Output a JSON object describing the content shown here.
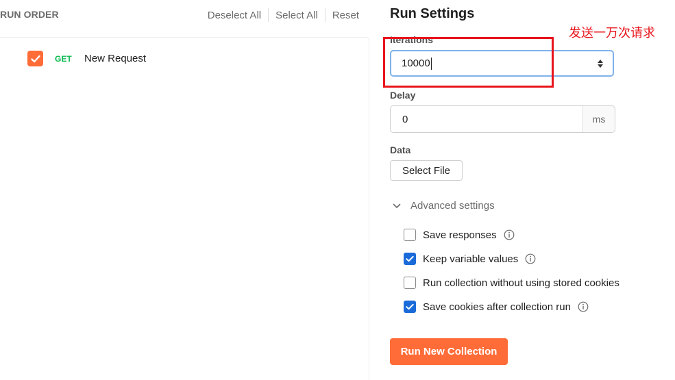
{
  "run_order": {
    "title": "RUN ORDER",
    "actions": {
      "deselect_all": "Deselect All",
      "select_all": "Select All",
      "reset": "Reset"
    },
    "requests": [
      {
        "method": "GET",
        "name": "New Request",
        "checked": true
      }
    ]
  },
  "run_settings": {
    "title": "Run Settings",
    "iterations": {
      "label": "Iterations",
      "value": "10000"
    },
    "delay": {
      "label": "Delay",
      "value": "0",
      "unit": "ms"
    },
    "data": {
      "label": "Data",
      "button": "Select File"
    },
    "advanced": {
      "label": "Advanced settings",
      "options": [
        {
          "label": "Save responses",
          "checked": false,
          "info": true
        },
        {
          "label": "Keep variable values",
          "checked": true,
          "info": true
        },
        {
          "label": "Run collection without using stored cookies",
          "checked": false,
          "info": false
        },
        {
          "label": "Save cookies after collection run",
          "checked": true,
          "info": true
        }
      ]
    },
    "run_button": "Run New Collection"
  },
  "annotation": {
    "text": "发送一万次请求"
  },
  "colors": {
    "accent": "#ff6c37",
    "checkbox_on": "#1a6bd9",
    "get_method": "#0cbb52",
    "annotation": "#e8141b",
    "focus_border": "#7fb2e9"
  }
}
